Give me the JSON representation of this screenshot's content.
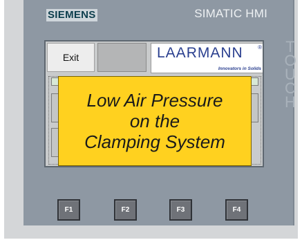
{
  "device": {
    "brand": "SIEMENS",
    "model": "SIMATIC HMI",
    "touch_label": "TOUCH"
  },
  "screen": {
    "exit_label": "Exit",
    "logo": {
      "name": "LAARMANN",
      "registered": "®",
      "tagline": "Innovators in Solids"
    },
    "alarm": {
      "line1": "Low Air Pressure",
      "line2": "on the",
      "line3": "Clamping System",
      "color": "#ffd11f"
    }
  },
  "function_keys": [
    "F1",
    "F2",
    "F3",
    "F4"
  ]
}
